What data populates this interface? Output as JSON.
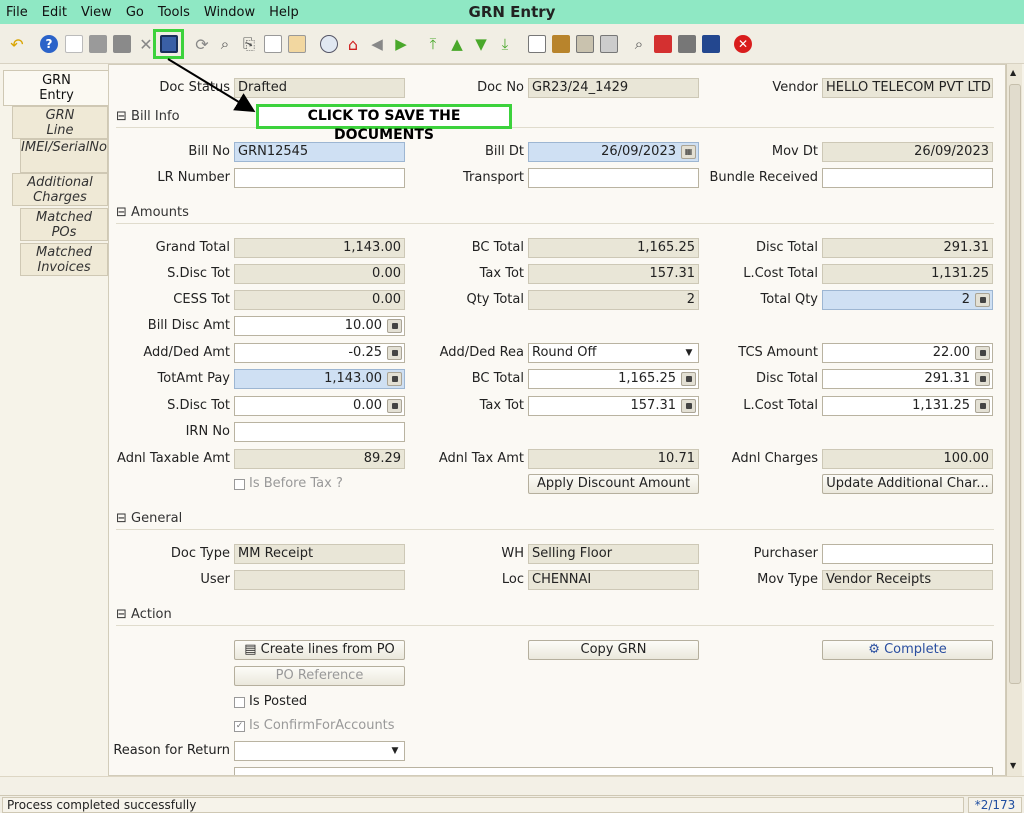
{
  "window": {
    "title": "GRN Entry"
  },
  "menu": [
    "File",
    "Edit",
    "View",
    "Go",
    "Tools",
    "Window",
    "Help"
  ],
  "toolbar": {
    "icons": [
      "undo-icon",
      "help-icon",
      "new-icon",
      "copy-icon",
      "delete-icon",
      "delete-selection-icon",
      "save-icon",
      "refresh-icon",
      "find-icon",
      "attachment-icon",
      "chat-icon",
      "grid-toggle-icon",
      "history-icon",
      "home-icon",
      "back-icon",
      "forward-icon",
      "first-record-icon",
      "previous-record-icon",
      "next-record-icon",
      "last-record-icon",
      "report-icon",
      "archive-icon",
      "print-preview-icon",
      "print-icon",
      "zoom-across-icon",
      "request-icon",
      "product-info-icon",
      "workflow-icon",
      "end-icon"
    ]
  },
  "annotation": {
    "text": "CLICK TO SAVE THE DOCUMENTS"
  },
  "tabs": [
    {
      "label": "GRN\nEntry",
      "active": true
    },
    {
      "label": "GRN\nLine"
    },
    {
      "label": "IMEI/SerialNo"
    },
    {
      "label": "Additional\nCharges"
    },
    {
      "label": "Matched\nPOs"
    },
    {
      "label": "Matched\nInvoices"
    }
  ],
  "header": {
    "doc_status_label": "Doc Status",
    "doc_status": "Drafted",
    "doc_no_label": "Doc No",
    "doc_no": "GR23/24_1429",
    "vendor_label": "Vendor",
    "vendor": "HELLO TELECOM PVT LTD"
  },
  "bill_info": {
    "section": "Bill Info",
    "bill_no_label": "Bill No",
    "bill_no": "GRN12545",
    "bill_dt_label": "Bill Dt",
    "bill_dt": "26/09/2023",
    "mov_dt_label": "Mov Dt",
    "mov_dt": "26/09/2023",
    "lr_number_label": "LR Number",
    "lr_number": "",
    "transport_label": "Transport",
    "transport": "",
    "bundle_received_label": "Bundle Received",
    "bundle_received": ""
  },
  "amounts": {
    "section": "Amounts",
    "grand_total_label": "Grand Total",
    "grand_total": "1,143.00",
    "bc_total_label": "BC Total",
    "bc_total": "1,165.25",
    "disc_total_label": "Disc Total",
    "disc_total": "291.31",
    "sdisc_tot_label": "S.Disc Tot",
    "sdisc_tot": "0.00",
    "tax_tot_label": "Tax Tot",
    "tax_tot": "157.31",
    "lcost_total_label": "L.Cost Total",
    "lcost_total": "1,131.25",
    "cess_tot_label": "CESS Tot",
    "cess_tot": "0.00",
    "qty_total_label": "Qty Total",
    "qty_total": "2",
    "total_qty_label": "Total Qty",
    "total_qty": "2",
    "bill_disc_amt_label": "Bill Disc Amt",
    "bill_disc_amt": "10.00",
    "add_ded_amt_label": "Add/Ded Amt",
    "add_ded_amt": "-0.25",
    "add_ded_rea_label": "Add/Ded Rea",
    "add_ded_rea": "Round Off",
    "tcs_amount_label": "TCS Amount",
    "tcs_amount": "22.00",
    "totamt_pay_label": "TotAmt Pay",
    "totamt_pay": "1,143.00",
    "bc_total2_label": "BC Total",
    "bc_total2": "1,165.25",
    "disc_total2_label": "Disc Total",
    "disc_total2": "291.31",
    "sdisc_tot2_label": "S.Disc Tot",
    "sdisc_tot2": "0.00",
    "tax_tot2_label": "Tax Tot",
    "tax_tot2": "157.31",
    "lcost_total2_label": "L.Cost Total",
    "lcost_total2": "1,131.25",
    "irn_no_label": "IRN No",
    "irn_no": "",
    "adnl_taxable_amt_label": "Adnl Taxable Amt",
    "adnl_taxable_amt": "89.29",
    "adnl_tax_amt_label": "Adnl Tax Amt",
    "adnl_tax_amt": "10.71",
    "adnl_charges_label": "Adnl Charges",
    "adnl_charges": "100.00",
    "is_before_tax_label": "Is Before Tax ?",
    "apply_discount_button": "Apply Discount Amount",
    "update_additional_button": "Update Additional Char..."
  },
  "general": {
    "section": "General",
    "doc_type_label": "Doc Type",
    "doc_type": "MM Receipt",
    "wh_label": "WH",
    "wh": "Selling Floor",
    "purchaser_label": "Purchaser",
    "purchaser": "",
    "user_label": "User",
    "user": "",
    "loc_label": "Loc",
    "loc": "CHENNAI",
    "mov_type_label": "Mov Type",
    "mov_type": "Vendor Receipts"
  },
  "action": {
    "section": "Action",
    "create_lines_button": "Create lines from PO",
    "copy_grn_button": "Copy GRN",
    "complete_button": "Complete",
    "po_reference_button": "PO Reference",
    "is_posted_label": "Is Posted",
    "is_confirm_label": "Is ConfirmForAccounts",
    "reason_for_return_label": "Reason for Return",
    "reason_for_return": ""
  },
  "status": {
    "message": "Process completed successfully",
    "record": "*2/173"
  },
  "colors": {
    "menubar": "#8fe8c4",
    "highlight": "#3cd23c",
    "field_focus": "#cfe0f3"
  }
}
